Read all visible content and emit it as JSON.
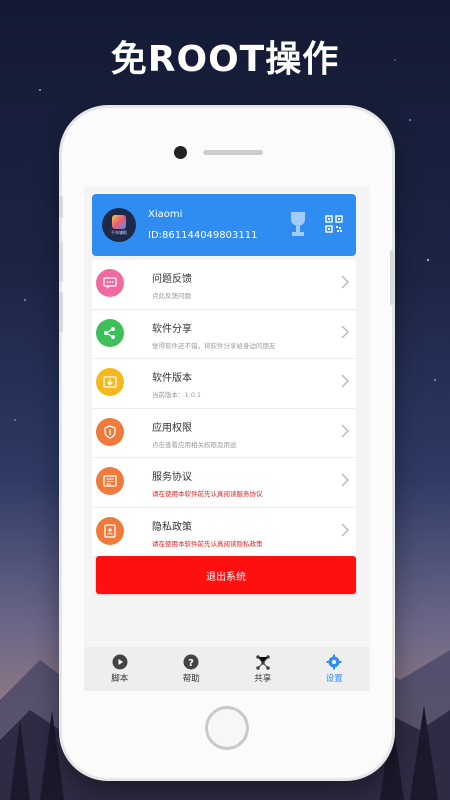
{
  "hero_title": "免ROOT操作",
  "profile": {
    "name": "Xiaomi",
    "id_text": "ID:861144049803111",
    "icon_caption": "千年辅助"
  },
  "menu": [
    {
      "title": "问题反馈",
      "subtitle": "点此反馈问题",
      "icon": "feedback-icon",
      "color": "#f06aa0",
      "subtitle_red": false
    },
    {
      "title": "软件分享",
      "subtitle": "觉得软件还不错，将软件分享给身边的朋友",
      "icon": "share-icon",
      "color": "#3fbf5a",
      "subtitle_red": false
    },
    {
      "title": "软件版本",
      "subtitle": "当前版本：1.0.1",
      "icon": "version-icon",
      "color": "#f5b91e",
      "subtitle_red": false
    },
    {
      "title": "应用权限",
      "subtitle": "点击查看应用相关权限及用途",
      "icon": "permission-shield-icon",
      "color": "#f07a3c",
      "subtitle_red": false
    },
    {
      "title": "服务协议",
      "subtitle": "请在使用本软件前先认真阅读服务协议",
      "icon": "agreement-icon",
      "color": "#f07a3c",
      "subtitle_red": true
    },
    {
      "title": "隐私政策",
      "subtitle": "请在使用本软件前先认真阅读隐私政策",
      "icon": "privacy-icon",
      "color": "#f07a3c",
      "subtitle_red": true
    }
  ],
  "logout_label": "退出系统",
  "tabs": [
    {
      "label": "脚本",
      "icon": "play-icon"
    },
    {
      "label": "帮助",
      "icon": "help-icon"
    },
    {
      "label": "共享",
      "icon": "share-nodes-icon"
    },
    {
      "label": "设置",
      "icon": "settings-gear-icon",
      "active": true
    }
  ],
  "colors": {
    "accent": "#2f8df2",
    "logout": "#ff1010",
    "warning_text": "#e02020"
  }
}
